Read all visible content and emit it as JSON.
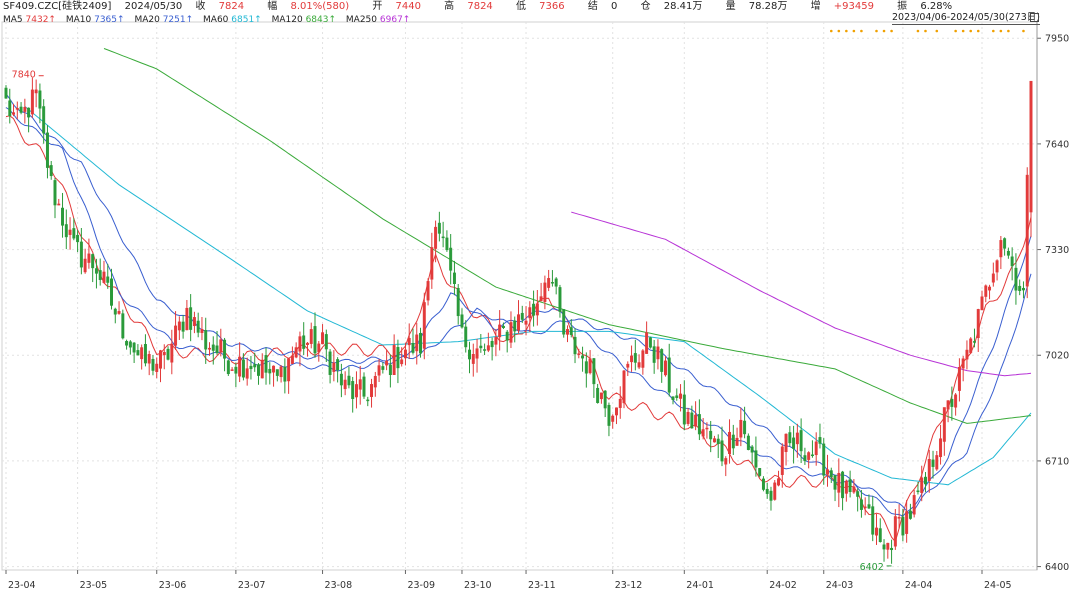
{
  "header": {
    "symbol": "SF409.CZC[硅铁2409]",
    "date": "2024/05/30",
    "close_label": "收",
    "close": "7824",
    "change_label": "幅",
    "change": "8.01%(580)",
    "open_label": "开",
    "open": "7440",
    "high_label": "高",
    "high": "7824",
    "low_label": "低",
    "low": "7366",
    "settle_label": "结",
    "settle": "0",
    "oi_label": "仓",
    "oi": "28.41万",
    "volume_label": "量",
    "volume": "78.28万",
    "oi_change_label": "增",
    "oi_change": "+93459",
    "amplitude_label": "振",
    "amplitude": "6.28%"
  },
  "range_label": "2023/04/06-2024/05/30(273日)",
  "ma_legend": [
    {
      "name": "MA5",
      "value": "7432↑",
      "color": "#e23a3a"
    },
    {
      "name": "MA10",
      "value": "7365↑",
      "color": "#3a5fd0"
    },
    {
      "name": "MA20",
      "value": "7251↑",
      "color": "#3a5fd0"
    },
    {
      "name": "MA60",
      "value": "6851↑",
      "color": "#22b8d4"
    },
    {
      "name": "MA120",
      "value": "6843↑",
      "color": "#3aaa3a"
    },
    {
      "name": "MA250",
      "value": "6967↑",
      "color": "#b733d6"
    }
  ],
  "colors": {
    "up": "#e23a3a",
    "down": "#2a9a3a",
    "grid": "#e2e2e2"
  },
  "chart_data": {
    "type": "candlestick",
    "y_ticks": [
      6400,
      6710,
      7020,
      7330,
      7640,
      7950
    ],
    "ylim": [
      6390,
      7980
    ],
    "x_labels": [
      "23-04",
      "23-05",
      "23-06",
      "23-07",
      "23-08",
      "23-09",
      "23-10",
      "23-11",
      "23-12",
      "24-01",
      "24-02",
      "24-03",
      "24-04",
      "24-05"
    ],
    "x_label_day_index": [
      0,
      19,
      40,
      61,
      84,
      106,
      121,
      138,
      161,
      180,
      202,
      217,
      238,
      259
    ],
    "n_days": 273,
    "annotations": [
      {
        "text": "7840",
        "day": 10,
        "value": 7840
      },
      {
        "text": "6402",
        "day": 235,
        "value": 6402
      }
    ],
    "anchors": [
      [
        0,
        7760
      ],
      [
        3,
        7700
      ],
      [
        8,
        7780
      ],
      [
        12,
        7520
      ],
      [
        18,
        7330
      ],
      [
        24,
        7280
      ],
      [
        30,
        7120
      ],
      [
        36,
        7000
      ],
      [
        42,
        7000
      ],
      [
        48,
        7150
      ],
      [
        53,
        7060
      ],
      [
        60,
        7000
      ],
      [
        65,
        7000
      ],
      [
        72,
        6950
      ],
      [
        78,
        7060
      ],
      [
        84,
        7050
      ],
      [
        90,
        6920
      ],
      [
        95,
        6900
      ],
      [
        102,
        7000
      ],
      [
        106,
        7040
      ],
      [
        110,
        7050
      ],
      [
        114,
        7440
      ],
      [
        117,
        7300
      ],
      [
        121,
        7070
      ],
      [
        127,
        7020
      ],
      [
        134,
        7110
      ],
      [
        140,
        7150
      ],
      [
        144,
        7280
      ],
      [
        148,
        7080
      ],
      [
        154,
        7000
      ],
      [
        160,
        6850
      ],
      [
        166,
        7000
      ],
      [
        171,
        7060
      ],
      [
        175,
        6960
      ],
      [
        180,
        6840
      ],
      [
        185,
        6800
      ],
      [
        190,
        6730
      ],
      [
        195,
        6830
      ],
      [
        199,
        6680
      ],
      [
        203,
        6600
      ],
      [
        207,
        6750
      ],
      [
        211,
        6760
      ],
      [
        217,
        6710
      ],
      [
        222,
        6620
      ],
      [
        228,
        6560
      ],
      [
        233,
        6440
      ],
      [
        236,
        6510
      ],
      [
        240,
        6560
      ],
      [
        244,
        6640
      ],
      [
        248,
        6800
      ],
      [
        252,
        6920
      ],
      [
        256,
        7050
      ],
      [
        260,
        7200
      ],
      [
        264,
        7380
      ],
      [
        268,
        7250
      ],
      [
        270,
        7200
      ],
      [
        272,
        7824
      ]
    ],
    "ma_series": [
      {
        "name": "MA5",
        "points": [
          [
            0,
            7720
          ],
          [
            12,
            7580
          ],
          [
            24,
            7280
          ],
          [
            40,
            7040
          ],
          [
            60,
            7010
          ],
          [
            84,
            7040
          ],
          [
            106,
            7030
          ],
          [
            114,
            7300
          ],
          [
            121,
            7180
          ],
          [
            134,
            7050
          ],
          [
            144,
            7200
          ],
          [
            160,
            6900
          ],
          [
            180,
            6820
          ],
          [
            203,
            6650
          ],
          [
            222,
            6650
          ],
          [
            236,
            6490
          ],
          [
            250,
            6880
          ],
          [
            260,
            7150
          ],
          [
            268,
            7280
          ],
          [
            272,
            7430
          ]
        ]
      },
      {
        "name": "MA10",
        "points": [
          [
            0,
            7740
          ],
          [
            15,
            7620
          ],
          [
            30,
            7200
          ],
          [
            45,
            7050
          ],
          [
            65,
            7000
          ],
          [
            90,
            6980
          ],
          [
            106,
            7010
          ],
          [
            118,
            7200
          ],
          [
            130,
            7100
          ],
          [
            145,
            7160
          ],
          [
            165,
            6980
          ],
          [
            185,
            6830
          ],
          [
            205,
            6700
          ],
          [
            225,
            6640
          ],
          [
            238,
            6540
          ],
          [
            250,
            6720
          ],
          [
            262,
            7050
          ],
          [
            272,
            7365
          ]
        ]
      },
      {
        "name": "MA20",
        "points": [
          [
            0,
            7780
          ],
          [
            20,
            7580
          ],
          [
            40,
            7180
          ],
          [
            60,
            7050
          ],
          [
            90,
            7000
          ],
          [
            110,
            7020
          ],
          [
            125,
            7150
          ],
          [
            140,
            7080
          ],
          [
            150,
            7130
          ],
          [
            170,
            7050
          ],
          [
            190,
            6900
          ],
          [
            210,
            6730
          ],
          [
            230,
            6620
          ],
          [
            240,
            6560
          ],
          [
            255,
            6740
          ],
          [
            265,
            7000
          ],
          [
            272,
            7251
          ]
        ]
      },
      {
        "name": "MA60",
        "points": [
          [
            5,
            7750
          ],
          [
            30,
            7520
          ],
          [
            60,
            7300
          ],
          [
            80,
            7150
          ],
          [
            100,
            7050
          ],
          [
            120,
            7060
          ],
          [
            140,
            7090
          ],
          [
            160,
            7090
          ],
          [
            180,
            7060
          ],
          [
            200,
            6900
          ],
          [
            220,
            6730
          ],
          [
            235,
            6660
          ],
          [
            250,
            6640
          ],
          [
            262,
            6720
          ],
          [
            272,
            6851
          ]
        ]
      },
      {
        "name": "MA120",
        "points": [
          [
            26,
            7920
          ],
          [
            40,
            7860
          ],
          [
            70,
            7650
          ],
          [
            100,
            7420
          ],
          [
            130,
            7220
          ],
          [
            160,
            7110
          ],
          [
            190,
            7040
          ],
          [
            220,
            6980
          ],
          [
            240,
            6880
          ],
          [
            255,
            6820
          ],
          [
            272,
            6843
          ]
        ]
      },
      {
        "name": "MA250",
        "points": [
          [
            150,
            7440
          ],
          [
            175,
            7360
          ],
          [
            200,
            7210
          ],
          [
            220,
            7100
          ],
          [
            240,
            7020
          ],
          [
            255,
            6975
          ],
          [
            265,
            6960
          ],
          [
            272,
            6967
          ]
        ]
      }
    ]
  }
}
